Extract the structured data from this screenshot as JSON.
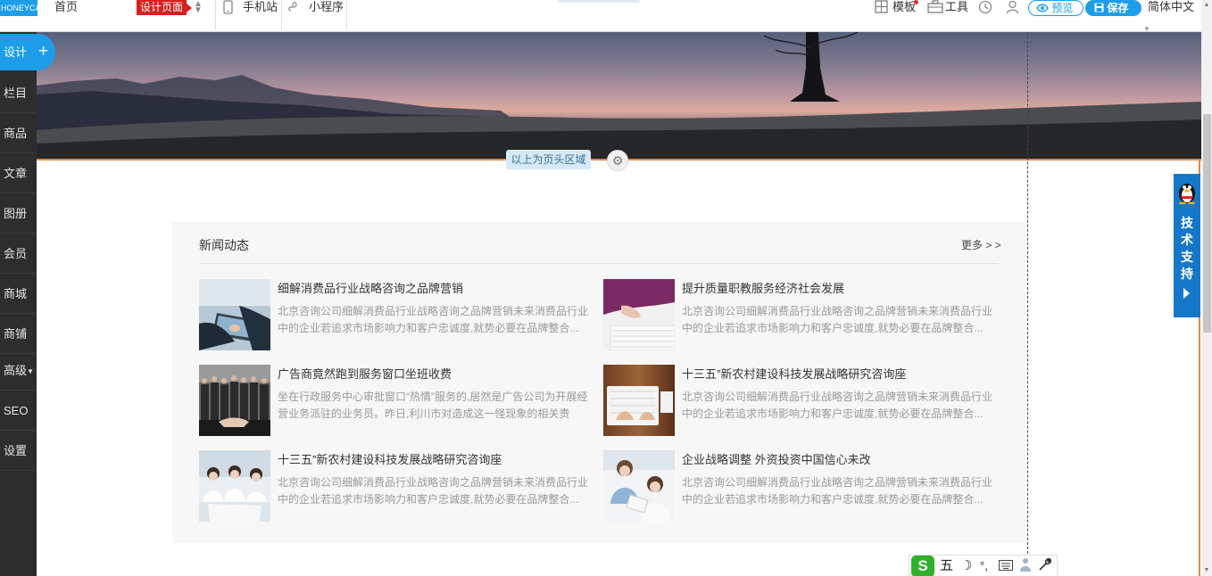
{
  "topbar": {
    "logo_text": "HONEYCAM",
    "home": "首页",
    "design_page": "设计页面",
    "mobile": "手机站",
    "mini_program": "小程序",
    "template": "模板",
    "tools": "工具",
    "preview": "预览",
    "save": "保存",
    "language": "简体中文"
  },
  "sidebar": {
    "design": "设计",
    "items": [
      "栏目",
      "商品",
      "文章",
      "图册",
      "会员",
      "商城",
      "商铺",
      "高级",
      "SEO",
      "设置"
    ]
  },
  "header_tip": "以上为页头区域",
  "support": {
    "text": "技术支持"
  },
  "news": {
    "title": "新闻动态",
    "more": "更多 > >",
    "items": [
      {
        "title": "细解消费品行业战略咨询之品牌营销",
        "desc": "北京咨询公司细解消费品行业战略咨询之品牌营销未来消费品行业中的企业若追求市场影响力和客户忠诚度,就势必要在品牌整合..."
      },
      {
        "title": "提升质量职教服务经济社会发展",
        "desc": "北京咨询公司细解消费品行业战略咨询之品牌营销未来消费品行业中的企业若追求市场影响力和客户忠诚度,就势必要在品牌整合..."
      },
      {
        "title": "广告商竟然跑到服务窗口坐班收费",
        "desc": "坐在行政服务中心审批窗口“热情”服务的,居然是广告公司为开展经营业务派驻的业务员。昨日,利川市对造成这一怪现象的相关责"
      },
      {
        "title": "十三五”新农村建设科技发展战略研究咨询座",
        "desc": "北京咨询公司细解消费品行业战略咨询之品牌营销未来消费品行业中的企业若追求市场影响力和客户忠诚度,就势必要在品牌整合..."
      },
      {
        "title": "十三五”新农村建设科技发展战略研究咨询座",
        "desc": "北京咨询公司细解消费品行业战略咨询之品牌营销未来消费品行业中的企业若追求市场影响力和客户忠诚度,就势必要在品牌整合..."
      },
      {
        "title": "企业战略调整 外资投资中国信心未改",
        "desc": "北京咨询公司细解消费品行业战略咨询之品牌营销未来消费品行业中的企业若追求市场影响力和客户忠诚度,就势必要在品牌整合..."
      }
    ]
  },
  "ime": {
    "badge": "S",
    "mode": "五"
  },
  "colors": {
    "accent": "#1e9ee9",
    "sidebar": "#2d2d2d",
    "badge_red": "#d81e1e",
    "support_blue": "#1577c8",
    "divider_orange": "#e38a3f"
  }
}
